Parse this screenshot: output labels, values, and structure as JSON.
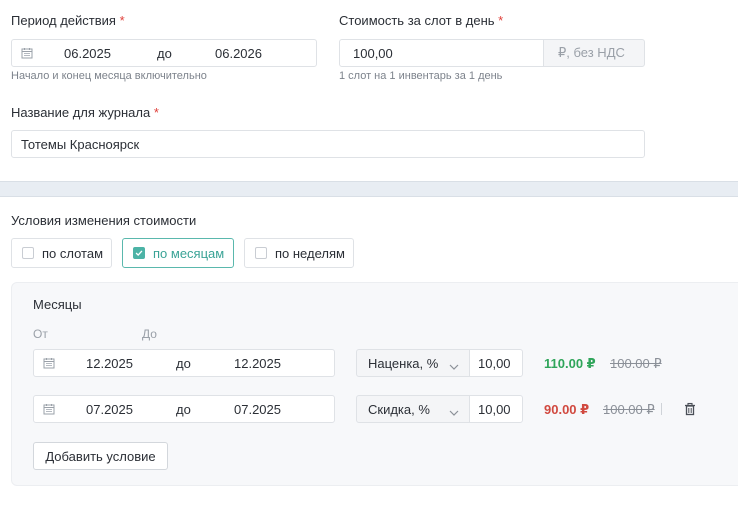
{
  "period": {
    "label": "Период действия",
    "required": "*",
    "from": "06.2025",
    "sep": "до",
    "to": "06.2026",
    "hint": "Начало и конец месяца включительно"
  },
  "cost": {
    "label": "Стоимость за слот в день",
    "required": "*",
    "value": "100,00",
    "addon": "₽, без НДС",
    "hint": "1 слот на 1 инвентарь за 1 день"
  },
  "journal": {
    "label": "Название для журнала",
    "required": "*",
    "value": "Тотемы Красноярск"
  },
  "conditions": {
    "label": "Условия изменения стоимости",
    "options": [
      {
        "label": "по слотам",
        "checked": false
      },
      {
        "label": "по месяцам",
        "checked": true
      },
      {
        "label": "по неделям",
        "checked": false
      }
    ]
  },
  "months": {
    "title": "Месяцы",
    "col_from": "От",
    "col_to": "До",
    "rows": [
      {
        "from": "12.2025",
        "sep": "до",
        "to": "12.2025",
        "type": "Наценка, %",
        "value": "10,00",
        "new_price": "110.00 ₽",
        "old_price": "100.00 ₽",
        "direction": "up"
      },
      {
        "from": "07.2025",
        "sep": "до",
        "to": "07.2025",
        "type": "Скидка, %",
        "value": "10,00",
        "new_price": "90.00 ₽",
        "old_price": "100.00 ₽",
        "direction": "down"
      }
    ],
    "add_button": "Добавить условие"
  },
  "colors": {
    "accent": "#4cb3a6",
    "up": "#2fa55a",
    "down": "#d1493f",
    "required": "#e0403a"
  }
}
